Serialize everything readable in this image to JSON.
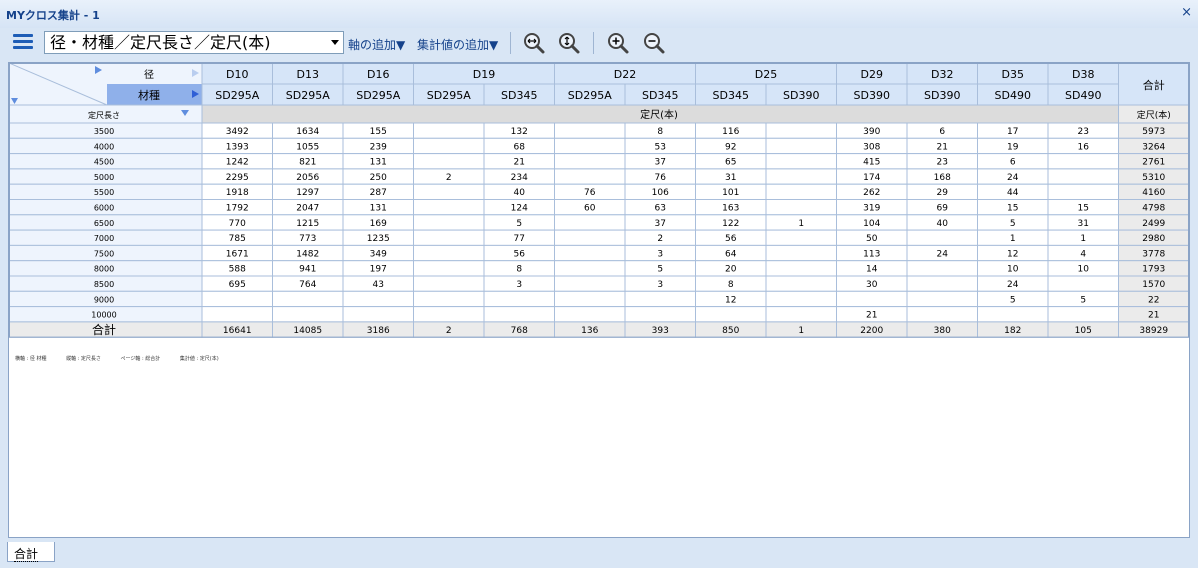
{
  "window": {
    "title": "MYクロス集計 - 1",
    "close_label": "×"
  },
  "toolbar": {
    "combo_value": "径・材種／定尺長さ／定尺(本)",
    "add_axis_label": "軸の追加▼",
    "add_value_label": "集計値の追加▼",
    "icons": [
      "fit-width-icon",
      "fit-height-icon",
      "zoom-in-icon",
      "zoom-out-icon"
    ]
  },
  "grid": {
    "header_labels": {
      "diameter": "径",
      "material": "材種",
      "row_axis": "定尺長さ",
      "value_caption": "定尺(本)",
      "total": "合計",
      "total_value_caption": "定尺(本)"
    },
    "diameter_groups": [
      {
        "label": "D10",
        "span": 1
      },
      {
        "label": "D13",
        "span": 1
      },
      {
        "label": "D16",
        "span": 1
      },
      {
        "label": "D19",
        "span": 2
      },
      {
        "label": "D22",
        "span": 2
      },
      {
        "label": "D25",
        "span": 2
      },
      {
        "label": "D29",
        "span": 1
      },
      {
        "label": "D32",
        "span": 1
      },
      {
        "label": "D35",
        "span": 1
      },
      {
        "label": "D38",
        "span": 1
      }
    ],
    "materials": [
      "SD295A",
      "SD295A",
      "SD295A",
      "SD295A",
      "SD345",
      "SD295A",
      "SD345",
      "SD345",
      "SD390",
      "SD390",
      "SD390",
      "SD490",
      "SD490"
    ],
    "rows": [
      {
        "length": "3500",
        "values": [
          "3492",
          "1634",
          "155",
          "",
          "132",
          "",
          "8",
          "116",
          "",
          "390",
          "6",
          "17",
          "23"
        ],
        "total": "5973"
      },
      {
        "length": "4000",
        "values": [
          "1393",
          "1055",
          "239",
          "",
          "68",
          "",
          "53",
          "92",
          "",
          "308",
          "21",
          "19",
          "16"
        ],
        "total": "3264"
      },
      {
        "length": "4500",
        "values": [
          "1242",
          "821",
          "131",
          "",
          "21",
          "",
          "37",
          "65",
          "",
          "415",
          "23",
          "6",
          ""
        ],
        "total": "2761"
      },
      {
        "length": "5000",
        "values": [
          "2295",
          "2056",
          "250",
          "2",
          "234",
          "",
          "76",
          "31",
          "",
          "174",
          "168",
          "24",
          ""
        ],
        "total": "5310"
      },
      {
        "length": "5500",
        "values": [
          "1918",
          "1297",
          "287",
          "",
          "40",
          "76",
          "106",
          "101",
          "",
          "262",
          "29",
          "44",
          ""
        ],
        "total": "4160"
      },
      {
        "length": "6000",
        "values": [
          "1792",
          "2047",
          "131",
          "",
          "124",
          "60",
          "63",
          "163",
          "",
          "319",
          "69",
          "15",
          "15"
        ],
        "total": "4798"
      },
      {
        "length": "6500",
        "values": [
          "770",
          "1215",
          "169",
          "",
          "5",
          "",
          "37",
          "122",
          "1",
          "104",
          "40",
          "5",
          "31"
        ],
        "total": "2499"
      },
      {
        "length": "7000",
        "values": [
          "785",
          "773",
          "1235",
          "",
          "77",
          "",
          "2",
          "56",
          "",
          "50",
          "",
          "1",
          "1"
        ],
        "total": "2980"
      },
      {
        "length": "7500",
        "values": [
          "1671",
          "1482",
          "349",
          "",
          "56",
          "",
          "3",
          "64",
          "",
          "113",
          "24",
          "12",
          "4"
        ],
        "total": "3778"
      },
      {
        "length": "8000",
        "values": [
          "588",
          "941",
          "197",
          "",
          "8",
          "",
          "5",
          "20",
          "",
          "14",
          "",
          "10",
          "10"
        ],
        "total": "1793"
      },
      {
        "length": "8500",
        "values": [
          "695",
          "764",
          "43",
          "",
          "3",
          "",
          "3",
          "8",
          "",
          "30",
          "",
          "24",
          ""
        ],
        "total": "1570"
      },
      {
        "length": "9000",
        "values": [
          "",
          "",
          "",
          "",
          "",
          "",
          "",
          "12",
          "",
          "",
          "",
          "5",
          "5"
        ],
        "total": "22"
      },
      {
        "length": "10000",
        "values": [
          "",
          "",
          "",
          "",
          "",
          "",
          "",
          "",
          "",
          "21",
          "",
          "",
          ""
        ],
        "total": "21"
      }
    ],
    "totals_row": {
      "label": "合計",
      "values": [
        "16641",
        "14085",
        "3186",
        "2",
        "768",
        "136",
        "393",
        "850",
        "1",
        "2200",
        "380",
        "182",
        "105"
      ],
      "total": "38929"
    },
    "colors": {
      "header_bg": "#d6e5f8",
      "material_highlight": "#8fb0ea",
      "total_bg": "#ebebeb",
      "caption_bg": "#dcdcdc",
      "line": "#a9bedb",
      "arrow": "#5f8dde"
    }
  },
  "footnote": {
    "col_axis": "横軸 : 径 材種",
    "row_axis": "縦軸 : 定尺長さ",
    "page_axis": "ページ軸 : 総合計",
    "value": "集計値 : 定尺(本)"
  },
  "sheet_tabs": [
    {
      "label": "合計"
    }
  ]
}
